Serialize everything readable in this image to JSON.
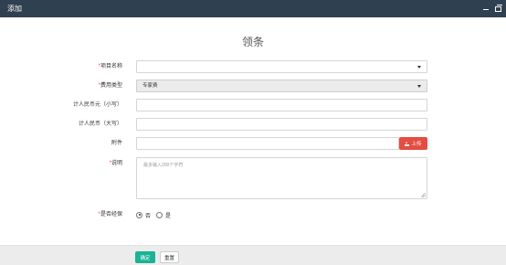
{
  "window": {
    "title": "添加"
  },
  "form": {
    "title": "领条",
    "project_name": {
      "label": "项目名称",
      "value": ""
    },
    "fee_type": {
      "label": "费用类型",
      "value": "专家费"
    },
    "amount_lower": {
      "label": "计人民币元（小写）",
      "value": ""
    },
    "amount_upper": {
      "label": "计人民币（大写）",
      "value": ""
    },
    "attachment": {
      "label": "附件",
      "value": "",
      "upload_label": "上传"
    },
    "description": {
      "label": "说明",
      "placeholder": "最多输入200个字符"
    },
    "is_contract": {
      "label": "是否经保",
      "options": [
        "否",
        "是"
      ],
      "selected": "否"
    }
  },
  "footer": {
    "confirm_label": "确定",
    "reset_label": "重置"
  },
  "colors": {
    "titlebar": "#2f4050",
    "primary": "#1ab394",
    "danger": "#e54d42",
    "required": "#e74c3c"
  }
}
